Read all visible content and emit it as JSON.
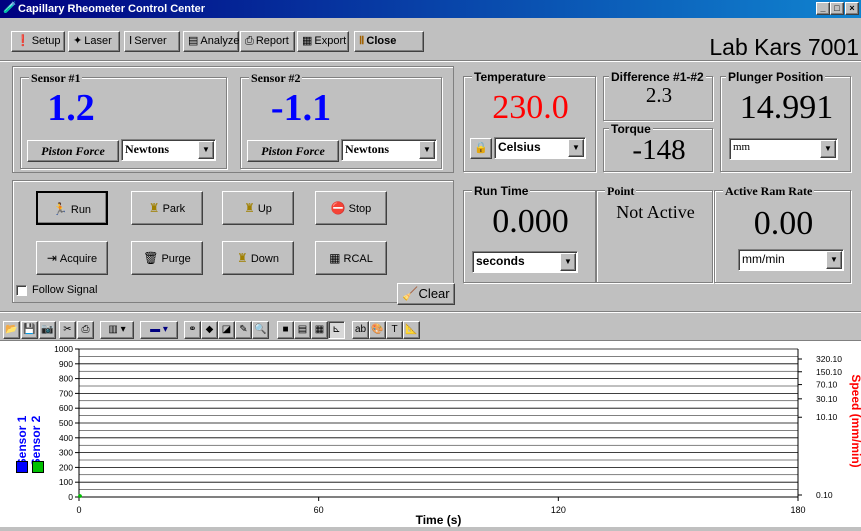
{
  "window": {
    "title": "Capillary Rheometer Control Center",
    "min": "_",
    "max": "□",
    "close": "×"
  },
  "toolbar": {
    "setup": "Setup",
    "laser": "Laser",
    "server": "Server",
    "analyze": "Analyze",
    "report": "Report",
    "export": "Export",
    "close": "Close"
  },
  "lab_name": "Lab Kars 7001",
  "sensor1": {
    "title": "Sensor #1",
    "value": "1.2",
    "button": "Piston Force",
    "unit": "Newtons"
  },
  "sensor2": {
    "title": "Sensor #2",
    "value": "-1.1",
    "button": "Piston Force",
    "unit": "Newtons"
  },
  "temperature": {
    "title": "Temperature",
    "value": "230.0",
    "unit": "Celsius",
    "color": "#ff0000"
  },
  "difference": {
    "title": "Difference #1-#2",
    "value": "2.3"
  },
  "torque": {
    "title": "Torque",
    "value": "-148"
  },
  "plunger": {
    "title": "Plunger Position",
    "value": "14.991",
    "unit": "mm"
  },
  "run_time": {
    "title": "Run Time",
    "value": "0.000",
    "unit": "seconds"
  },
  "point": {
    "title": "Point",
    "value": "Not Active"
  },
  "ram_rate": {
    "title": "Active Ram Rate",
    "value": "0.00",
    "unit": "mm/min"
  },
  "buttons": {
    "run": "Run",
    "park": "Park",
    "up": "Up",
    "stop": "Stop",
    "acquire": "Acquire",
    "purge": "Purge",
    "down": "Down",
    "rcal": "RCAL",
    "clear": "Clear"
  },
  "follow_signal": {
    "label": "Follow Signal",
    "checked": false
  },
  "chart_data": {
    "type": "line",
    "xlabel": "Time (s)",
    "ylabel_left": [
      "Sensor 1",
      "Sensor 2"
    ],
    "ylabel_right": "Speed (mm/min)",
    "xlim": [
      0,
      180
    ],
    "x_ticks": [
      "0",
      "60",
      "120",
      "180"
    ],
    "ylim": [
      0,
      1000
    ],
    "y_ticks": [
      "0",
      "100",
      "200",
      "300",
      "400",
      "500",
      "600",
      "700",
      "800",
      "900",
      "1000"
    ],
    "y2_ticks": [
      "320.10",
      "150.10",
      "70.10",
      "30.10",
      "10.10",
      "0.10"
    ],
    "y2_scale": "log",
    "grid": true,
    "series": [
      {
        "name": "Sensor 1",
        "color": "#0000ff",
        "x": [
          0
        ],
        "y": [
          0
        ]
      },
      {
        "name": "Sensor 2",
        "color": "#00c000",
        "x": [
          0
        ],
        "y": [
          0
        ]
      }
    ],
    "colors": {
      "sensor_label": "#0000ff",
      "speed_label": "#ff0000",
      "point": "#00c000"
    }
  }
}
